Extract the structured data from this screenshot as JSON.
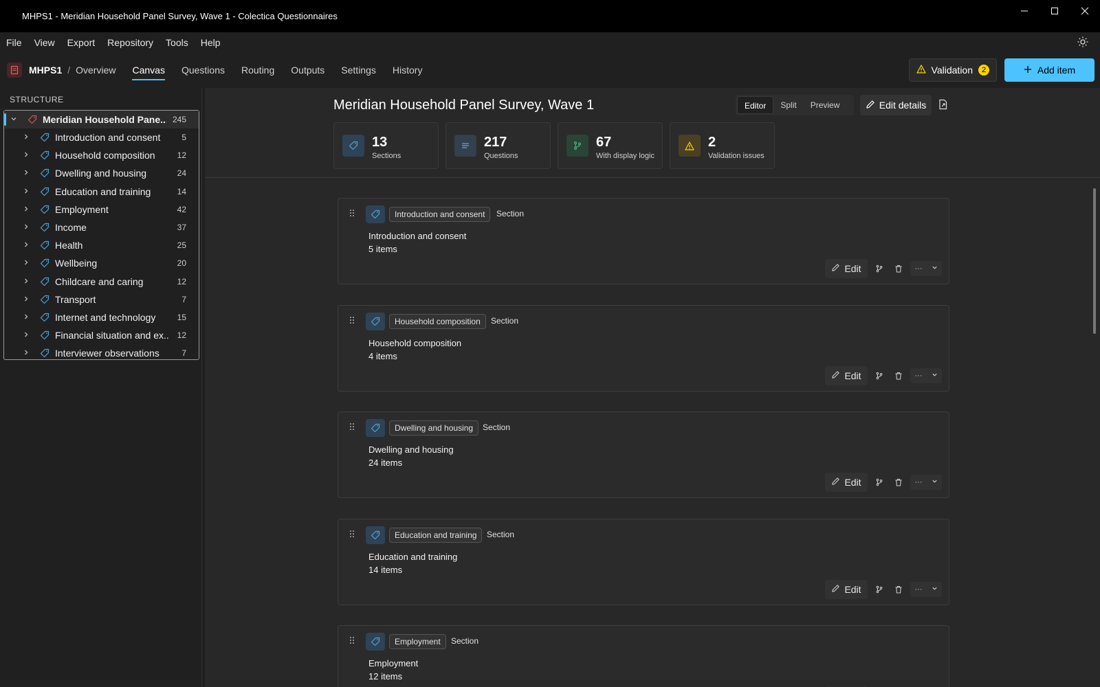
{
  "window": {
    "title": "MHPS1 - Meridian Household Panel Survey, Wave 1 - Colectica Questionnaires",
    "controls": [
      "minimize",
      "maximize",
      "close"
    ]
  },
  "menu": [
    "File",
    "View",
    "Export",
    "Repository",
    "Tools",
    "Help"
  ],
  "nav": {
    "project": "MHPS1",
    "separator": "/",
    "tabs": [
      "Overview",
      "Canvas",
      "Questions",
      "Routing",
      "Outputs",
      "Settings",
      "History"
    ],
    "active_tab": "Canvas",
    "validation_label": "Validation",
    "validation_count": "2",
    "add_item_label": "Add item"
  },
  "sidebar": {
    "title": "STRUCTURE",
    "root": {
      "label": "Meridian Household Pane...",
      "count": "245"
    },
    "items": [
      {
        "label": "Introduction and consent",
        "count": "5"
      },
      {
        "label": "Household composition",
        "count": "12"
      },
      {
        "label": "Dwelling and housing",
        "count": "24"
      },
      {
        "label": "Education and training",
        "count": "14"
      },
      {
        "label": "Employment",
        "count": "42"
      },
      {
        "label": "Income",
        "count": "37"
      },
      {
        "label": "Health",
        "count": "25"
      },
      {
        "label": "Wellbeing",
        "count": "20"
      },
      {
        "label": "Childcare and caring",
        "count": "12"
      },
      {
        "label": "Transport",
        "count": "7"
      },
      {
        "label": "Internet and technology",
        "count": "15"
      },
      {
        "label": "Financial situation and ex...",
        "count": "12"
      },
      {
        "label": "Interviewer observations",
        "count": "7"
      }
    ]
  },
  "main": {
    "title": "Meridian Household Panel Survey, Wave 1",
    "view_modes": [
      "Editor",
      "Split",
      "Preview"
    ],
    "active_mode": "Editor",
    "edit_details_label": "Edit details",
    "stats": [
      {
        "value": "13",
        "label": "Sections",
        "icon": "tag-icon"
      },
      {
        "value": "217",
        "label": "Questions",
        "icon": "lines-icon"
      },
      {
        "value": "67",
        "label": "With display logic",
        "icon": "branch-icon"
      },
      {
        "value": "2",
        "label": "Validation issues",
        "icon": "warning-icon"
      }
    ],
    "cards": [
      {
        "chip": "Introduction and consent",
        "type": "Section",
        "title": "Introduction and consent",
        "count": "5  items"
      },
      {
        "chip": "Household composition",
        "type": "Section",
        "title": "Household composition",
        "count": "4  items"
      },
      {
        "chip": "Dwelling and housing",
        "type": "Section",
        "title": "Dwelling and housing",
        "count": "24  items"
      },
      {
        "chip": "Education and training",
        "type": "Section",
        "title": "Education and training",
        "count": "14  items"
      },
      {
        "chip": "Employment",
        "type": "Section",
        "title": "Employment",
        "count": "12  items"
      }
    ],
    "card_edit_label": "Edit"
  },
  "colors": {
    "accent": "#4cc2ff",
    "warning": "#ffd400",
    "tag_blue": "#4ea3d8",
    "tag_red": "#d9534f",
    "logic_green": "#4caf80"
  }
}
